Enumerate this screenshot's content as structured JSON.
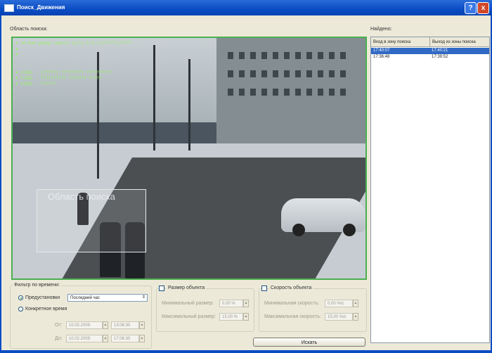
{
  "window": {
    "title": "Поиск_Движения"
  },
  "labels": {
    "search_area": "Область поиска:",
    "found": "Найдено:"
  },
  "video": {
    "osd_lines": [
      "▼ 10-Kam-pdmpp-camera-1[vl]-0.0.1=[?????]/????",
      "▲",
      "▼",
      "▼ F1DBL - [?????] ????????? ??????????",
      "▼ F1DBL - ?????????? ??????? ?????",
      "▼ F1DBL - ??????"
    ],
    "region_label": "Область поиска"
  },
  "results": {
    "columns": [
      "Вход в зону поиска",
      "Выход из зоны поиска"
    ],
    "rows": [
      {
        "enter": "17:40:07",
        "exit": "17:40:21"
      },
      {
        "enter": "17:36:48",
        "exit": "17:39:52"
      }
    ]
  },
  "time_filter": {
    "legend": "Фильтр по времени:",
    "predefined_label": "Предустановки",
    "predefined_value": "Последний час",
    "exact_label": "Конкретное время",
    "from_label": "От:",
    "from_date": "10.02.2009",
    "from_time": "13:06:30",
    "to_label": "До:",
    "to_date": "10.02.2009",
    "to_time": "17:06:30"
  },
  "object_size": {
    "legend": "Размер объекта",
    "min_label": "Минимальный размер:",
    "min_value": "0,00 %",
    "max_label": "Максимальный размер:",
    "max_value": "15,00 %"
  },
  "object_speed": {
    "legend": "Скорость объекта",
    "min_label": "Минимальная скорость:",
    "min_value": "0,00 %/c",
    "max_label": "Максимальная скорость:",
    "max_value": "15,00 %/c"
  },
  "buttons": {
    "search": "Искать"
  },
  "icons": {
    "help": "?",
    "close": "x",
    "spin_up": "▲",
    "spin_down": "▼",
    "dropdown": "⇕"
  }
}
